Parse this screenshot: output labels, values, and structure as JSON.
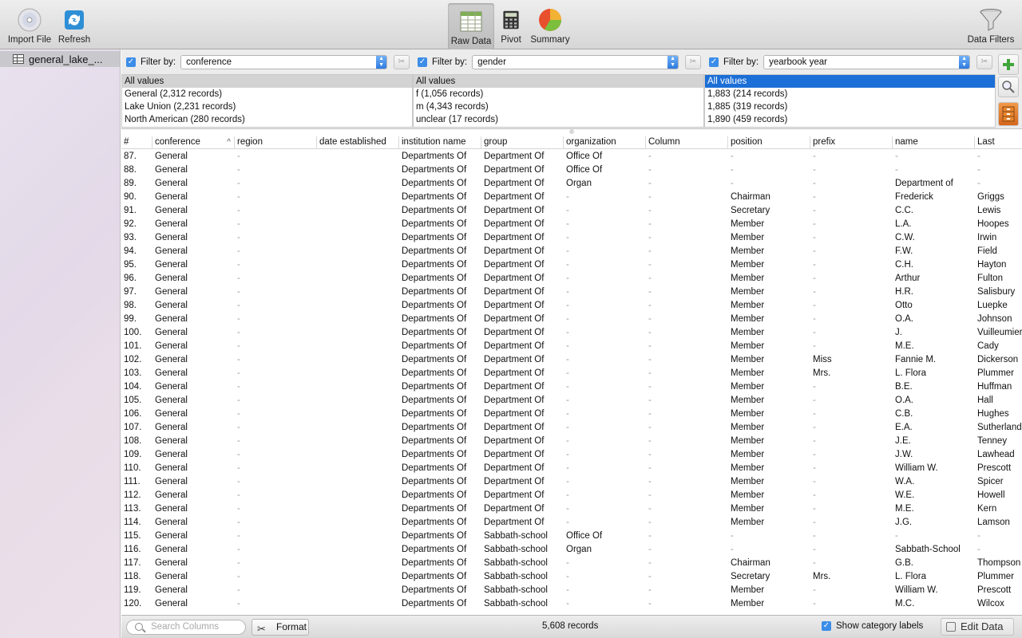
{
  "toolbar": {
    "import_label": "Import File",
    "refresh_label": "Refresh",
    "raw_label": "Raw Data",
    "pivot_label": "Pivot",
    "summary_label": "Summary",
    "filters_label": "Data Filters"
  },
  "sidebar": {
    "items": [
      {
        "label": "general_lake_..."
      }
    ]
  },
  "filters": [
    {
      "label": "Filter by:",
      "field": "conference",
      "values": [
        "All values",
        "General (2,312 records)",
        "Lake Union (2,231 records)",
        "North American (280 records)"
      ]
    },
    {
      "label": "Filter by:",
      "field": "gender",
      "values": [
        "All values",
        "f (1,056 records)",
        "m (4,343 records)",
        "unclear (17 records)"
      ]
    },
    {
      "label": "Filter by:",
      "field": "yearbook year",
      "values": [
        "All values",
        "1,883 (214 records)",
        "1,885 (319 records)",
        "1,890 (459 records)"
      ]
    }
  ],
  "table": {
    "columns": [
      "#",
      "conference",
      "region",
      "date established",
      "institution name",
      "group",
      "organization",
      "Column",
      "position",
      "prefix",
      "name",
      "Last"
    ],
    "rows": [
      [
        "87.",
        "General",
        "-",
        "",
        "Departments Of",
        "Department Of",
        "Office Of",
        "-",
        "-",
        "-",
        "-",
        "-"
      ],
      [
        "88.",
        "General",
        "-",
        "",
        "Departments Of",
        "Department Of",
        "Office Of",
        "-",
        "-",
        "-",
        "-",
        "-"
      ],
      [
        "89.",
        "General",
        "-",
        "",
        "Departments Of",
        "Department Of",
        "Organ",
        "-",
        "-",
        "-",
        "Department of",
        "-"
      ],
      [
        "90.",
        "General",
        "-",
        "",
        "Departments Of",
        "Department Of",
        "-",
        "-",
        "Chairman",
        "-",
        "Frederick",
        "Griggs"
      ],
      [
        "91.",
        "General",
        "-",
        "",
        "Departments Of",
        "Department Of",
        "-",
        "-",
        "Secretary",
        "-",
        "C.C.",
        "Lewis"
      ],
      [
        "92.",
        "General",
        "-",
        "",
        "Departments Of",
        "Department Of",
        "-",
        "-",
        "Member",
        "-",
        "L.A.",
        "Hoopes"
      ],
      [
        "93.",
        "General",
        "-",
        "",
        "Departments Of",
        "Department Of",
        "-",
        "-",
        "Member",
        "-",
        "C.W.",
        "Irwin"
      ],
      [
        "94.",
        "General",
        "-",
        "",
        "Departments Of",
        "Department Of",
        "-",
        "-",
        "Member",
        "-",
        "F.W.",
        "Field"
      ],
      [
        "95.",
        "General",
        "-",
        "",
        "Departments Of",
        "Department Of",
        "-",
        "-",
        "Member",
        "-",
        "C.H.",
        "Hayton"
      ],
      [
        "96.",
        "General",
        "-",
        "",
        "Departments Of",
        "Department Of",
        "-",
        "-",
        "Member",
        "-",
        "Arthur",
        "Fulton"
      ],
      [
        "97.",
        "General",
        "-",
        "",
        "Departments Of",
        "Department Of",
        "-",
        "-",
        "Member",
        "-",
        "H.R.",
        "Salisbury"
      ],
      [
        "98.",
        "General",
        "-",
        "",
        "Departments Of",
        "Department Of",
        "-",
        "-",
        "Member",
        "-",
        "Otto",
        "Luepke"
      ],
      [
        "99.",
        "General",
        "-",
        "",
        "Departments Of",
        "Department Of",
        "-",
        "-",
        "Member",
        "-",
        "O.A.",
        "Johnson"
      ],
      [
        "100.",
        "General",
        "-",
        "",
        "Departments Of",
        "Department Of",
        "-",
        "-",
        "Member",
        "-",
        "J.",
        "Vuilleumier"
      ],
      [
        "101.",
        "General",
        "-",
        "",
        "Departments Of",
        "Department Of",
        "-",
        "-",
        "Member",
        "-",
        "M.E.",
        "Cady"
      ],
      [
        "102.",
        "General",
        "-",
        "",
        "Departments Of",
        "Department Of",
        "-",
        "-",
        "Member",
        "Miss",
        "Fannie M.",
        "Dickerson"
      ],
      [
        "103.",
        "General",
        "-",
        "",
        "Departments Of",
        "Department Of",
        "-",
        "-",
        "Member",
        "Mrs.",
        "L. Flora",
        "Plummer"
      ],
      [
        "104.",
        "General",
        "-",
        "",
        "Departments Of",
        "Department Of",
        "-",
        "-",
        "Member",
        "-",
        "B.E.",
        "Huffman"
      ],
      [
        "105.",
        "General",
        "-",
        "",
        "Departments Of",
        "Department Of",
        "-",
        "-",
        "Member",
        "-",
        "O.A.",
        "Hall"
      ],
      [
        "106.",
        "General",
        "-",
        "",
        "Departments Of",
        "Department Of",
        "-",
        "-",
        "Member",
        "-",
        "C.B.",
        "Hughes"
      ],
      [
        "107.",
        "General",
        "-",
        "",
        "Departments Of",
        "Department Of",
        "-",
        "-",
        "Member",
        "-",
        "E.A.",
        "Sutherland"
      ],
      [
        "108.",
        "General",
        "-",
        "",
        "Departments Of",
        "Department Of",
        "-",
        "-",
        "Member",
        "-",
        "J.E.",
        "Tenney"
      ],
      [
        "109.",
        "General",
        "-",
        "",
        "Departments Of",
        "Department Of",
        "-",
        "-",
        "Member",
        "-",
        "J.W.",
        "Lawhead"
      ],
      [
        "110.",
        "General",
        "-",
        "",
        "Departments Of",
        "Department Of",
        "-",
        "-",
        "Member",
        "-",
        "William W.",
        "Prescott"
      ],
      [
        "111.",
        "General",
        "-",
        "",
        "Departments Of",
        "Department Of",
        "-",
        "-",
        "Member",
        "-",
        "W.A.",
        "Spicer"
      ],
      [
        "112.",
        "General",
        "-",
        "",
        "Departments Of",
        "Department Of",
        "-",
        "-",
        "Member",
        "-",
        "W.E.",
        "Howell"
      ],
      [
        "113.",
        "General",
        "-",
        "",
        "Departments Of",
        "Department Of",
        "-",
        "-",
        "Member",
        "-",
        "M.E.",
        "Kern"
      ],
      [
        "114.",
        "General",
        "-",
        "",
        "Departments Of",
        "Department Of",
        "-",
        "-",
        "Member",
        "-",
        "J.G.",
        "Lamson"
      ],
      [
        "115.",
        "General",
        "-",
        "",
        "Departments Of",
        "Sabbath-school",
        "Office Of",
        "-",
        "-",
        "-",
        "-",
        "-"
      ],
      [
        "116.",
        "General",
        "-",
        "",
        "Departments Of",
        "Sabbath-school",
        "Organ",
        "-",
        "-",
        "-",
        "Sabbath-School",
        "-"
      ],
      [
        "117.",
        "General",
        "-",
        "",
        "Departments Of",
        "Sabbath-school",
        "-",
        "-",
        "Chairman",
        "-",
        "G.B.",
        "Thompson"
      ],
      [
        "118.",
        "General",
        "-",
        "",
        "Departments Of",
        "Sabbath-school",
        "-",
        "-",
        "Secretary",
        "Mrs.",
        "L. Flora",
        "Plummer"
      ],
      [
        "119.",
        "General",
        "-",
        "",
        "Departments Of",
        "Sabbath-school",
        "-",
        "-",
        "Member",
        "-",
        "William W.",
        "Prescott"
      ],
      [
        "120.",
        "General",
        "-",
        "",
        "Departments Of",
        "Sabbath-school",
        "-",
        "-",
        "Member",
        "-",
        "M.C.",
        "Wilcox"
      ]
    ]
  },
  "bottom": {
    "search_placeholder": "Search Columns",
    "format_label": "Format",
    "records_label": "5,608 records",
    "show_category_label": "Show category labels",
    "edit_label": "Edit Data"
  }
}
